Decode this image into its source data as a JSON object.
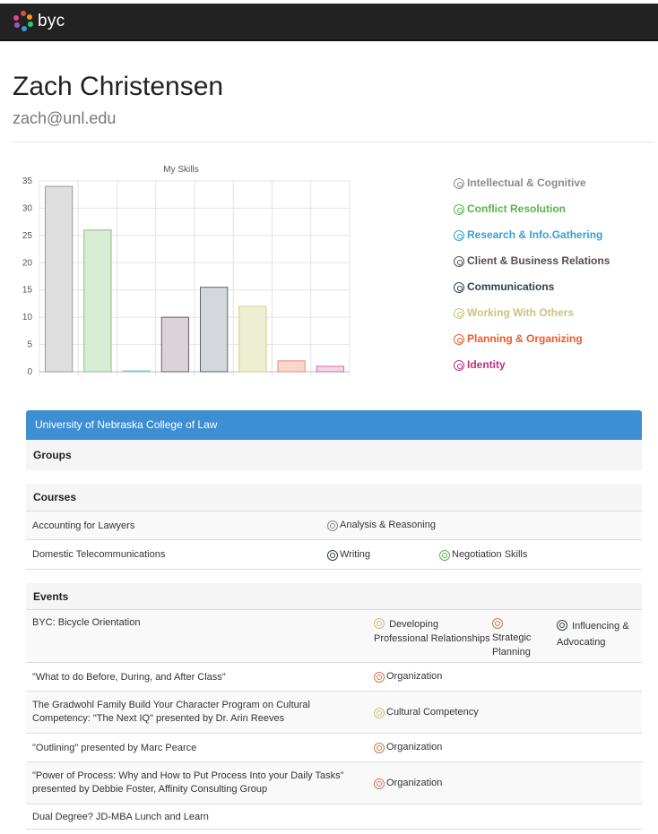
{
  "header": {
    "brand": "byc"
  },
  "profile": {
    "name": "Zach Christensen",
    "email": "zach@unl.edu"
  },
  "colors": {
    "intellectual": "#8a8a8a",
    "conflict": "#56b64a",
    "research": "#3a9fcf",
    "client": "#5b4a55",
    "communications": "#333f4c",
    "working": "#c9c47c",
    "planning": "#ec5a2a",
    "identity": "#c0307e",
    "panel_header": "#3d8ed3",
    "org_icon": "#c97a52"
  },
  "chart_data": {
    "type": "bar",
    "title": "My Skills",
    "categories": [
      "Intellectual & Cognitive",
      "Conflict Resolution",
      "Research & Info.Gathering",
      "Client & Business Relations",
      "Communications",
      "Working With Others",
      "Planning & Organizing",
      "Identity"
    ],
    "values": [
      34,
      26,
      0,
      10,
      15.5,
      12,
      2,
      1
    ],
    "yticks": [
      "0",
      "5",
      "10",
      "15",
      "20",
      "25",
      "30",
      "35"
    ],
    "ylim": [
      0,
      35
    ],
    "grid": true,
    "fill_colors": [
      "#dfdfdf",
      "#d8ecd6",
      "#d6ecf3",
      "#dcd3d8",
      "#d4d8dc",
      "#eeeed2",
      "#f7d6cd",
      "#f2d6e3"
    ],
    "stroke_colors": [
      "#9a9a9a",
      "#86c17e",
      "#7cc3db",
      "#6e5d68",
      "#5c6570",
      "#d4cf8c",
      "#ee8a66",
      "#cf6a9d"
    ]
  },
  "legend": [
    {
      "label": "Intellectual & Cognitive",
      "color": "#8a8a8a",
      "icon": "gear-icon"
    },
    {
      "label": "Conflict Resolution",
      "color": "#56b64a",
      "icon": "handshake-icon"
    },
    {
      "label": "Research & Info.Gathering",
      "color": "#3a9fcf",
      "icon": "magnifier-icon"
    },
    {
      "label": "Client & Business Relations",
      "color": "#5b4a55",
      "icon": "people-icon"
    },
    {
      "label": "Communications",
      "color": "#333f4c",
      "icon": "chat-icon"
    },
    {
      "label": "Working With Others",
      "color": "#c9c47c",
      "icon": "group-icon"
    },
    {
      "label": "Planning & Organizing",
      "color": "#ec5a2a",
      "icon": "clipboard-icon"
    },
    {
      "label": "Identity",
      "color": "#c0307e",
      "icon": "person-icon"
    }
  ],
  "panel": {
    "title": "University of Nebraska College of Law",
    "groups_title": "Groups",
    "courses_title": "Courses",
    "events_title": "Events"
  },
  "courses": [
    {
      "name": "Accounting for Lawyers",
      "skills": [
        {
          "label": "Analysis & Reasoning",
          "color": "#8a8a8a"
        }
      ]
    },
    {
      "name": "Domestic Telecommunications",
      "skills": [
        {
          "label": "Writing",
          "color": "#333f4c"
        },
        {
          "label": "Negotiation Skills",
          "color": "#56b64a"
        }
      ]
    }
  ],
  "events": [
    {
      "name": "BYC: Bicycle Orientation",
      "skills": [
        {
          "label": "Developing Professional Relationships",
          "color": "#c9c47c"
        },
        {
          "label": "Strategic Planning",
          "color": "#c97a52"
        },
        {
          "label": "Influencing & Advocating",
          "color": "#333f4c"
        }
      ]
    },
    {
      "name": "\"What to do Before, During, and After Class\"",
      "skills": [
        {
          "label": "Organization",
          "color": "#c97a52"
        }
      ]
    },
    {
      "name": "The Gradwohl Family Build Your Character Program on Cultural Competency: \"The Next IQ\" presented by Dr. Arin Reeves",
      "skills": [
        {
          "label": "Cultural Competency",
          "color": "#c9c47c"
        }
      ]
    },
    {
      "name": "\"Outlining\" presented by Marc Pearce",
      "skills": [
        {
          "label": "Organization",
          "color": "#c97a52"
        }
      ]
    },
    {
      "name": "\"Power of Process: Why and How to Put Process Into your Daily Tasks\" presented by Debbie Foster, Affinity Consulting Group",
      "skills": [
        {
          "label": "Organization",
          "color": "#c97a52"
        }
      ]
    },
    {
      "name": "Dual Degree? JD-MBA Lunch and Learn",
      "skills": []
    }
  ]
}
